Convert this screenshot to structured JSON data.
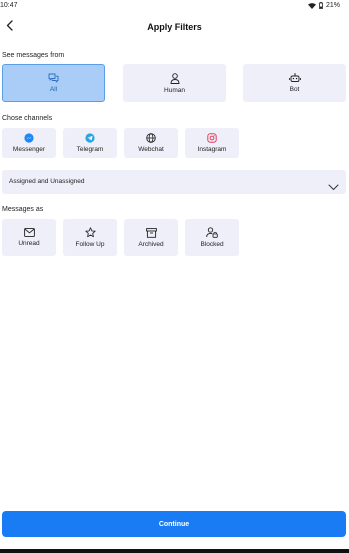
{
  "status_bar": {
    "time": "10:47",
    "battery": "21%"
  },
  "header": {
    "title": "Apply Filters"
  },
  "from_section": {
    "label": "See messages from",
    "options": [
      {
        "label": "All",
        "icon": "chat-bubbles-icon",
        "selected": true
      },
      {
        "label": "Human",
        "icon": "person-icon",
        "selected": false
      },
      {
        "label": "Bot",
        "icon": "bot-icon",
        "selected": false
      }
    ]
  },
  "channels_section": {
    "label": "Chose channels",
    "options": [
      {
        "label": "Messenger",
        "icon": "messenger-icon",
        "color": "#1e88f5"
      },
      {
        "label": "Telegram",
        "icon": "telegram-icon",
        "color": "#2aa3e0"
      },
      {
        "label": "Webchat",
        "icon": "globe-icon",
        "color": "#222222"
      },
      {
        "label": "Instagram",
        "icon": "instagram-icon",
        "color": "#e4405f"
      }
    ]
  },
  "assignment": {
    "value": "Assigned and Unassigned"
  },
  "messages_as_section": {
    "label": "Messages as",
    "options": [
      {
        "label": "Unread",
        "icon": "envelope-icon"
      },
      {
        "label": "Follow Up",
        "icon": "star-icon"
      },
      {
        "label": "Archived",
        "icon": "archive-icon"
      },
      {
        "label": "Blocked",
        "icon": "blocked-user-icon"
      }
    ]
  },
  "footer": {
    "continue_label": "Continue"
  },
  "colors": {
    "accent": "#1a7cf5",
    "tile_bg": "#eeeff9",
    "selected_bg": "#a9cdf7"
  }
}
